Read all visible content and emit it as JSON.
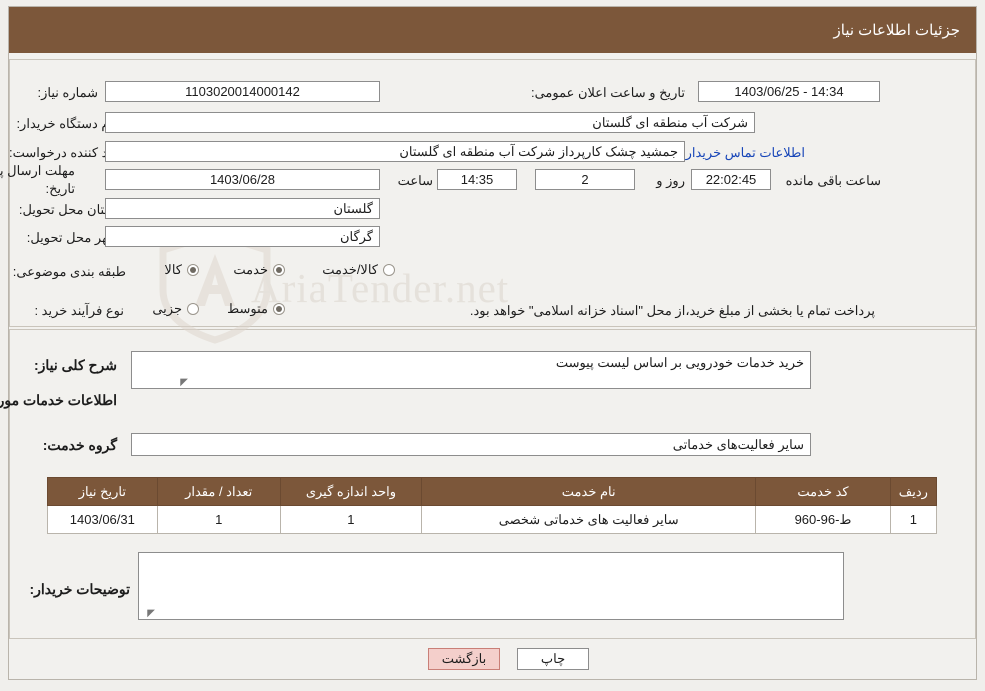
{
  "header": {
    "title": "جزئیات اطلاعات نیاز"
  },
  "watermark": {
    "text": "AriaTender.net"
  },
  "top": {
    "need_number_label": "شماره نیاز:",
    "need_number_value": "1103020014000142",
    "announce_datetime_label": "تاریخ و ساعت اعلان عمومی:",
    "announce_datetime_value": "14:34 - 1403/06/25",
    "buyer_org_label": "نام دستگاه خریدار:",
    "buyer_org_value": "شرکت آب منطقه ای گلستان",
    "requester_label": "ایجاد کننده درخواست:",
    "requester_value": "جمشید چشک کارپرداز شرکت آب منطقه ای گلستان",
    "buyer_contact_link": "اطلاعات تماس خریدار",
    "deadline_label": "مهلت ارسال پاسخ: تا تاریخ:",
    "deadline_date": "1403/06/28",
    "deadline_hour_label": "ساعت",
    "deadline_hour": "14:35",
    "days_value": "2",
    "days_label": "روز و",
    "timer_value": "22:02:45",
    "timer_label": "ساعت باقی مانده",
    "province_label": "استان محل تحویل:",
    "province_value": "گلستان",
    "city_label": "شهر محل تحویل:",
    "city_value": "گرگان",
    "category_label": "طبقه بندی موضوعی:",
    "category_options": [
      {
        "label": "کالا",
        "checked": true
      },
      {
        "label": "خدمت",
        "checked": true
      },
      {
        "label": "کالا/خدمت",
        "checked": false
      }
    ],
    "purchase_type_label": "نوع فرآیند خرید :",
    "purchase_type_options": [
      {
        "label": "جزیی",
        "checked": false
      },
      {
        "label": "متوسط",
        "checked": true
      }
    ],
    "payment_note": "پرداخت تمام یا بخشی از مبلغ خرید،از محل \"اسناد خزانه اسلامی\" خواهد بود."
  },
  "bottom": {
    "summary_label": "شرح کلی نیاز:",
    "summary_value": "خرید خدمات خودرویی بر اساس لیست پیوست",
    "services_heading": "اطلاعات خدمات مورد نیاز",
    "service_group_label": "گروه خدمت:",
    "service_group_value": "سایر فعالیت‌های خدماتی",
    "table": {
      "columns": [
        "ردیف",
        "کد خدمت",
        "نام خدمت",
        "واحد اندازه گیری",
        "تعداد / مقدار",
        "تاریخ نیاز"
      ],
      "rows": [
        {
          "row": "1",
          "code": "ط-96-960",
          "name": "سایر فعالیت های خدماتی شخصی",
          "unit": "1",
          "quantity": "1",
          "date": "1403/06/31"
        }
      ]
    },
    "buyer_notes_label": "توضیحات خریدار:",
    "buyer_notes_value": ""
  },
  "footer": {
    "print_button": "چاپ",
    "back_button": "بازگشت"
  }
}
